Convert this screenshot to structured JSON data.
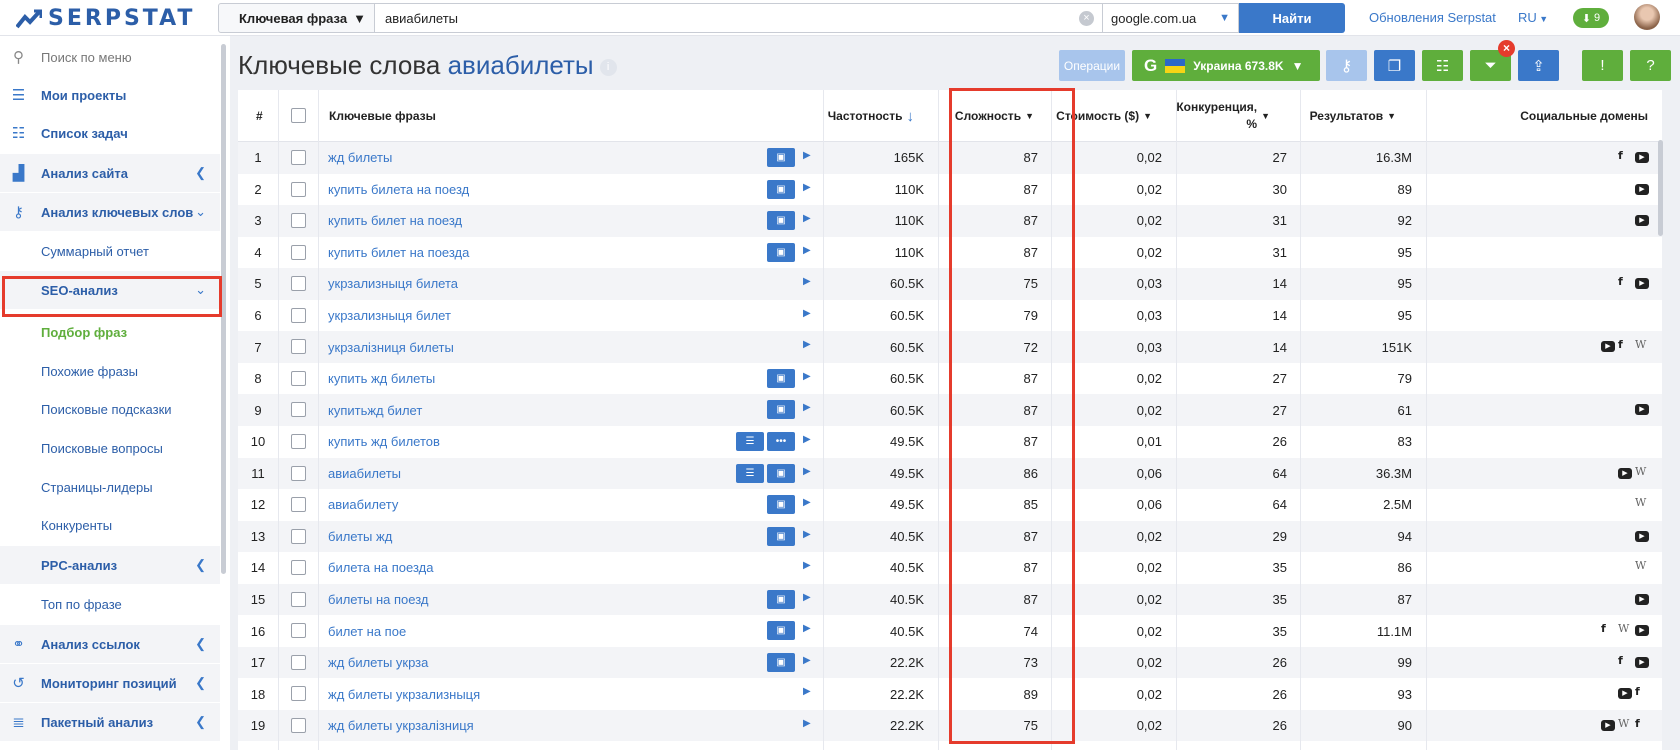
{
  "app": {
    "logo": "SERPSTAT"
  },
  "search": {
    "type_label": "Ключевая фраза",
    "query": "авиабилеты",
    "engine": "google.com.ua",
    "find_label": "Найти"
  },
  "top_nav": {
    "updates_label": "Обновления Serpstat",
    "lang": "RU",
    "downloads_count": "9"
  },
  "sidebar": {
    "search_placeholder": "Поиск по меню",
    "items": [
      {
        "label": "Мои проекты"
      },
      {
        "label": "Список задач"
      },
      {
        "label": "Анализ сайта"
      },
      {
        "label": "Анализ ключевых слов"
      },
      {
        "label": "Суммарный отчет"
      },
      {
        "label": "SEO-анализ"
      },
      {
        "label": "Подбор фраз"
      },
      {
        "label": "Похожие фразы"
      },
      {
        "label": "Поисковые подсказки"
      },
      {
        "label": "Поисковые вопросы"
      },
      {
        "label": "Страницы-лидеры"
      },
      {
        "label": "Конкуренты"
      },
      {
        "label": "PPC-анализ"
      },
      {
        "label": "Топ по фразе"
      },
      {
        "label": "Анализ ссылок"
      },
      {
        "label": "Мониторинг позиций"
      },
      {
        "label": "Пакетный анализ"
      }
    ]
  },
  "page": {
    "title_prefix": "Ключевые слова",
    "title_keyword": "авиабилеты"
  },
  "toolbar": {
    "operations_label": "Операции",
    "region_label": "Украина 673.8K",
    "colors": {
      "blue": "#3a78c9",
      "green": "#5fae3c"
    }
  },
  "table": {
    "columns": {
      "num": "#",
      "keyword": "Ключевые фразы",
      "frequency": "Частотность",
      "difficulty": "Сложность",
      "cost": "Стоимость ($)",
      "competition_line1": "Конкуренция,",
      "competition_line2": "%",
      "results": "Результатов",
      "social": "Социальные домены"
    },
    "rows": [
      {
        "n": "1",
        "kw": "жд билеты",
        "freq": "165K",
        "diff": "87",
        "cost": "0,02",
        "comp": "27",
        "res": "16.3M",
        "btns": [
          "img"
        ],
        "soc": [
          "fb",
          "yt"
        ]
      },
      {
        "n": "2",
        "kw": "купить билета на поезд",
        "freq": "110K",
        "diff": "87",
        "cost": "0,02",
        "comp": "30",
        "res": "89",
        "btns": [
          "img"
        ],
        "soc": [
          "yt"
        ]
      },
      {
        "n": "3",
        "kw": "купить билет на поезд",
        "freq": "110K",
        "diff": "87",
        "cost": "0,02",
        "comp": "31",
        "res": "92",
        "btns": [
          "img"
        ],
        "soc": [
          "yt"
        ]
      },
      {
        "n": "4",
        "kw": "купить билет на поезда",
        "freq": "110K",
        "diff": "87",
        "cost": "0,02",
        "comp": "31",
        "res": "95",
        "btns": [
          "img"
        ],
        "soc": []
      },
      {
        "n": "5",
        "kw": "укрзализныця билета",
        "freq": "60.5K",
        "diff": "75",
        "cost": "0,03",
        "comp": "14",
        "res": "95",
        "btns": [],
        "soc": [
          "fb",
          "yt"
        ]
      },
      {
        "n": "6",
        "kw": "укрзализныця билет",
        "freq": "60.5K",
        "diff": "79",
        "cost": "0,03",
        "comp": "14",
        "res": "95",
        "btns": [],
        "soc": []
      },
      {
        "n": "7",
        "kw": "укрзалізниця билеты",
        "freq": "60.5K",
        "diff": "72",
        "cost": "0,03",
        "comp": "14",
        "res": "151K",
        "btns": [],
        "soc": [
          "yt",
          "fb",
          "wk"
        ]
      },
      {
        "n": "8",
        "kw": "купить жд билеты",
        "freq": "60.5K",
        "diff": "87",
        "cost": "0,02",
        "comp": "27",
        "res": "79",
        "btns": [
          "img"
        ],
        "soc": []
      },
      {
        "n": "9",
        "kw": "купитьжд билет",
        "freq": "60.5K",
        "diff": "87",
        "cost": "0,02",
        "comp": "27",
        "res": "61",
        "btns": [
          "img"
        ],
        "soc": [
          "yt"
        ]
      },
      {
        "n": "10",
        "kw": "купить жд билетов",
        "freq": "49.5K",
        "diff": "87",
        "cost": "0,01",
        "comp": "26",
        "res": "83",
        "btns": [
          "list",
          "more"
        ],
        "soc": []
      },
      {
        "n": "11",
        "kw": "авиабилеты",
        "freq": "49.5K",
        "diff": "86",
        "cost": "0,06",
        "comp": "64",
        "res": "36.3M",
        "btns": [
          "list",
          "img"
        ],
        "soc": [
          "yt",
          "wk"
        ]
      },
      {
        "n": "12",
        "kw": "авиабилету",
        "freq": "49.5K",
        "diff": "85",
        "cost": "0,06",
        "comp": "64",
        "res": "2.5M",
        "btns": [
          "img"
        ],
        "soc": [
          "wk"
        ]
      },
      {
        "n": "13",
        "kw": "билеты жд",
        "freq": "40.5K",
        "diff": "87",
        "cost": "0,02",
        "comp": "29",
        "res": "94",
        "btns": [
          "img"
        ],
        "soc": [
          "yt"
        ]
      },
      {
        "n": "14",
        "kw": "билета на поезда",
        "freq": "40.5K",
        "diff": "87",
        "cost": "0,02",
        "comp": "35",
        "res": "86",
        "btns": [],
        "soc": [
          "wk"
        ]
      },
      {
        "n": "15",
        "kw": "билеты на поезд",
        "freq": "40.5K",
        "diff": "87",
        "cost": "0,02",
        "comp": "35",
        "res": "87",
        "btns": [
          "img"
        ],
        "soc": [
          "yt"
        ]
      },
      {
        "n": "16",
        "kw": "билет на пое",
        "freq": "40.5K",
        "diff": "74",
        "cost": "0,02",
        "comp": "35",
        "res": "11.1M",
        "btns": [
          "img"
        ],
        "soc": [
          "fb",
          "wk",
          "yt"
        ]
      },
      {
        "n": "17",
        "kw": "жд билеты укрза",
        "freq": "22.2K",
        "diff": "73",
        "cost": "0,02",
        "comp": "26",
        "res": "99",
        "btns": [
          "img"
        ],
        "soc": [
          "fb",
          "yt"
        ]
      },
      {
        "n": "18",
        "kw": "жд билеты укрзализныця",
        "freq": "22.2K",
        "diff": "89",
        "cost": "0,02",
        "comp": "26",
        "res": "93",
        "btns": [],
        "soc": [
          "yt",
          "fb"
        ]
      },
      {
        "n": "19",
        "kw": "жд билеты укрзалізниця",
        "freq": "22.2K",
        "diff": "75",
        "cost": "0,02",
        "comp": "26",
        "res": "90",
        "btns": [],
        "soc": [
          "yt",
          "wk",
          "fb"
        ]
      }
    ]
  }
}
